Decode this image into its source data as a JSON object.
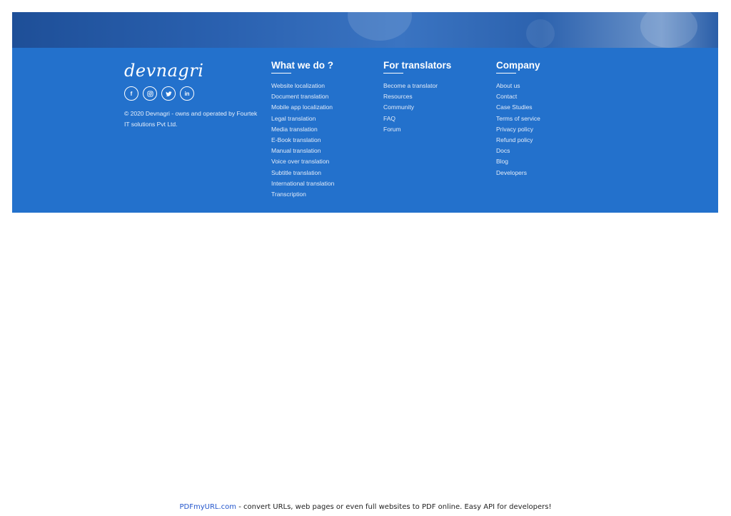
{
  "brand": {
    "logo_text": "devnagri",
    "copyright": "© 2020 Devnagri - owns and operated by Fourtek IT solutions Pvt Ltd.",
    "socials": [
      {
        "name": "facebook-icon",
        "glyph": "f"
      },
      {
        "name": "instagram-icon",
        "glyph": ""
      },
      {
        "name": "twitter-icon",
        "glyph": ""
      },
      {
        "name": "linkedin-icon",
        "glyph": "in"
      }
    ]
  },
  "columns": {
    "what_we_do": {
      "title": "What we do ?",
      "items": [
        "Website localization",
        "Document translation",
        "Mobile app localization",
        "Legal translation",
        "Media translation",
        "E-Book translation",
        "Manual translation",
        "Voice over translation",
        "Subtitle translation",
        "International translation",
        "Transcription"
      ]
    },
    "for_translators": {
      "title": "For translators",
      "items": [
        "Become a translator",
        "Resources",
        "Community",
        "FAQ",
        "Forum"
      ]
    },
    "company": {
      "title": "Company",
      "items": [
        "About us",
        "Contact",
        "Case Studies",
        "Terms of service",
        "Privacy policy",
        "Refund policy",
        "Docs",
        "Blog",
        "Developers"
      ]
    }
  },
  "pdfbar": {
    "link": "PDFmyURL.com",
    "text": " - convert URLs, web pages or even full websites to PDF online. Easy API for developers!"
  },
  "colors": {
    "footer_bg": "#2371cc",
    "hero_bg": "#2a61b0",
    "text": "#ffffff"
  }
}
